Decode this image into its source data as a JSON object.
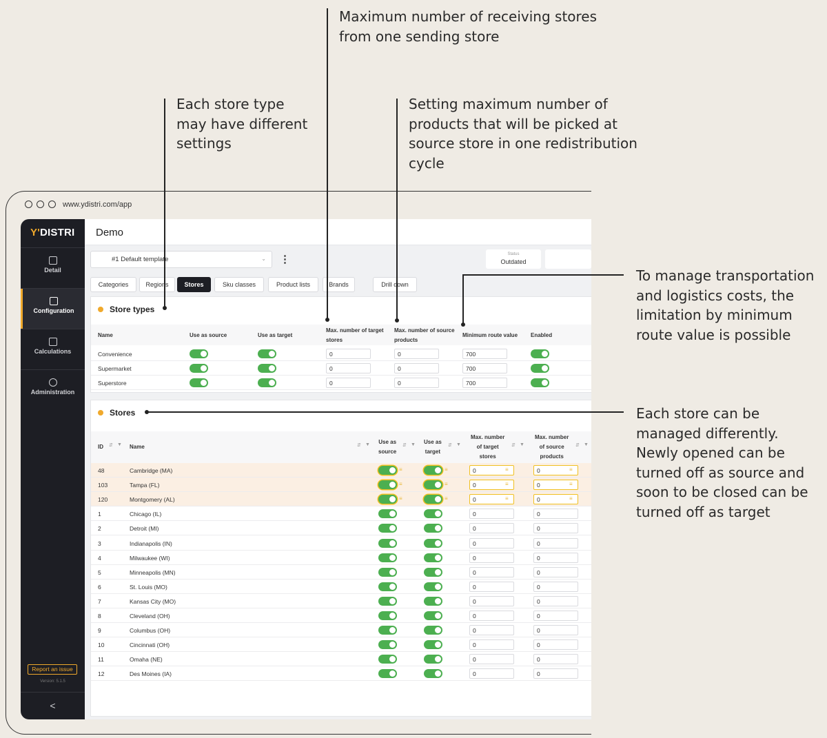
{
  "annotations": {
    "receiving": "Maximum number of receiving stores\nfrom one sending store",
    "store_type": "Each store type\nmay have different\nsettings",
    "products": "Setting maximum number of\nproducts that will be picked at\nsource store in one redistribution\ncycle",
    "route": "To manage transportation\nand logistics costs, the\nlimitation by minimum\nroute value is possible",
    "store": "Each store can be\nmanaged differently.\nNewly opened can be\nturned off as source and\nsoon to be closed can be\nturned off as target"
  },
  "browser": {
    "url": "www.ydistri.com/app"
  },
  "sidebar": {
    "logo_prefix": "Y'",
    "logo_rest": "DISTRI",
    "items": [
      {
        "label": "Detail",
        "icon": "detail-icon"
      },
      {
        "label": "Configuration",
        "icon": "configuration-icon"
      },
      {
        "label": "Calculations",
        "icon": "calculations-icon"
      },
      {
        "label": "Administration",
        "icon": "gear-icon"
      }
    ],
    "report": "Report an issue",
    "version": "Version: 5.1.5",
    "collapse": "<"
  },
  "header": {
    "title": "Demo"
  },
  "template": {
    "selected": "#1  Default template",
    "kebab": "⋮"
  },
  "status": {
    "label": "Status",
    "value": "Outdated"
  },
  "tabs": [
    "Categories",
    "Regions",
    "Stores",
    "Sku classes",
    "Product lists",
    "Brands",
    "Drill down"
  ],
  "store_types": {
    "title": "Store types",
    "headers": {
      "name": "Name",
      "source": "Use as source",
      "target": "Use as target",
      "max_target_1": "Max. number of target",
      "max_target_2": "stores",
      "max_source_1": "Max. number of source",
      "max_source_2": "products",
      "min_route": "Minimum route value",
      "enabled": "Enabled"
    },
    "rows": [
      {
        "name": "Convenience",
        "max_target": "0",
        "max_source": "0",
        "min_route": "700"
      },
      {
        "name": "Supermarket",
        "max_target": "0",
        "max_source": "0",
        "min_route": "700"
      },
      {
        "name": "Superstore",
        "max_target": "0",
        "max_source": "0",
        "min_route": "700"
      }
    ]
  },
  "stores": {
    "title": "Stores",
    "headers": {
      "id": "ID",
      "name": "Name",
      "source_1": "Use as",
      "source_2": "source",
      "target_1": "Use as",
      "target_2": "target",
      "mt_1": "Max. number",
      "mt_2": "of target",
      "mt_3": "stores",
      "ms_1": "Max. number",
      "ms_2": "of source",
      "ms_3": "products"
    },
    "rows": [
      {
        "id": "48",
        "name": "Cambridge (MA)",
        "max_target": "0",
        "max_source": "0"
      },
      {
        "id": "103",
        "name": "Tampa (FL)",
        "max_target": "0",
        "max_source": "0"
      },
      {
        "id": "120",
        "name": "Montgomery (AL)",
        "max_target": "0",
        "max_source": "0"
      },
      {
        "id": "1",
        "name": "Chicago (IL)",
        "max_target": "0",
        "max_source": "0"
      },
      {
        "id": "2",
        "name": "Detroit (MI)",
        "max_target": "0",
        "max_source": "0"
      },
      {
        "id": "3",
        "name": "Indianapolis (IN)",
        "max_target": "0",
        "max_source": "0"
      },
      {
        "id": "4",
        "name": "Milwaukee (WI)",
        "max_target": "0",
        "max_source": "0"
      },
      {
        "id": "5",
        "name": "Minneapolis (MN)",
        "max_target": "0",
        "max_source": "0"
      },
      {
        "id": "6",
        "name": "St. Louis (MO)",
        "max_target": "0",
        "max_source": "0"
      },
      {
        "id": "7",
        "name": "Kansas City (MO)",
        "max_target": "0",
        "max_source": "0"
      },
      {
        "id": "8",
        "name": "Cleveland (OH)",
        "max_target": "0",
        "max_source": "0"
      },
      {
        "id": "9",
        "name": "Columbus (OH)",
        "max_target": "0",
        "max_source": "0"
      },
      {
        "id": "10",
        "name": "Cincinnati (OH)",
        "max_target": "0",
        "max_source": "0"
      },
      {
        "id": "11",
        "name": "Omaha (NE)",
        "max_target": "0",
        "max_source": "0"
      },
      {
        "id": "12",
        "name": "Des Moines (IA)",
        "max_target": "0",
        "max_source": "0"
      }
    ]
  },
  "colors": {
    "accent": "#f0a92c",
    "toggle_on": "#4caf50",
    "sidebar": "#1d1e24",
    "highlight_row": "#fbefe3"
  }
}
